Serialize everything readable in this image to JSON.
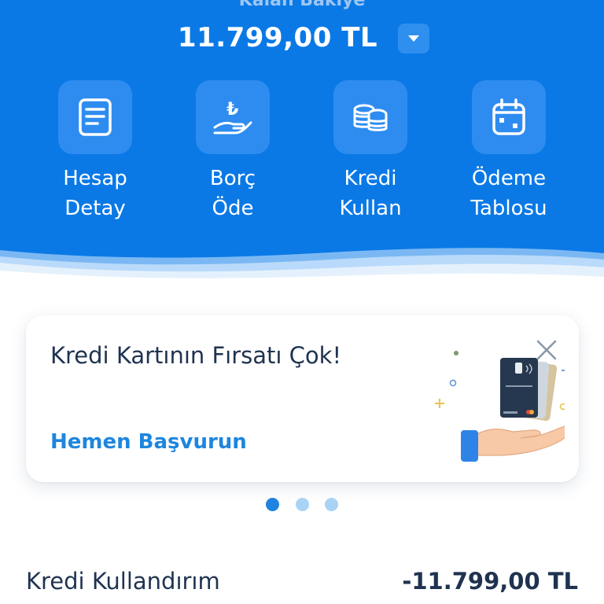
{
  "header": {
    "balance_label": "Kalan Bakiye",
    "balance_amount": "11.799,00 TL",
    "toggle_icon": "chevron-down-icon"
  },
  "actions": [
    {
      "line1": "Hesap",
      "line2": "Detay",
      "icon": "document-icon"
    },
    {
      "line1": "Borç",
      "line2": "Öde",
      "icon": "lira-hand-icon"
    },
    {
      "line1": "Kredi",
      "line2": "Kullan",
      "icon": "coins-icon"
    },
    {
      "line1": "Ödeme",
      "line2": "Tablosu",
      "icon": "calendar-icon"
    }
  ],
  "promo": {
    "title": "Kredi Kartının Fırsatı Çok!",
    "link": "Hemen Başvurun",
    "close_icon": "close-icon"
  },
  "carousel": {
    "count": 3,
    "active_index": 0
  },
  "summary_row": {
    "label": "Kredi Kullandırım",
    "value": "-11.799,00 TL"
  },
  "colors": {
    "header_bg": "#0a79e6",
    "tile_bg": "#2e8cf0",
    "link": "#1d86de",
    "text_dark": "#1f3350"
  }
}
